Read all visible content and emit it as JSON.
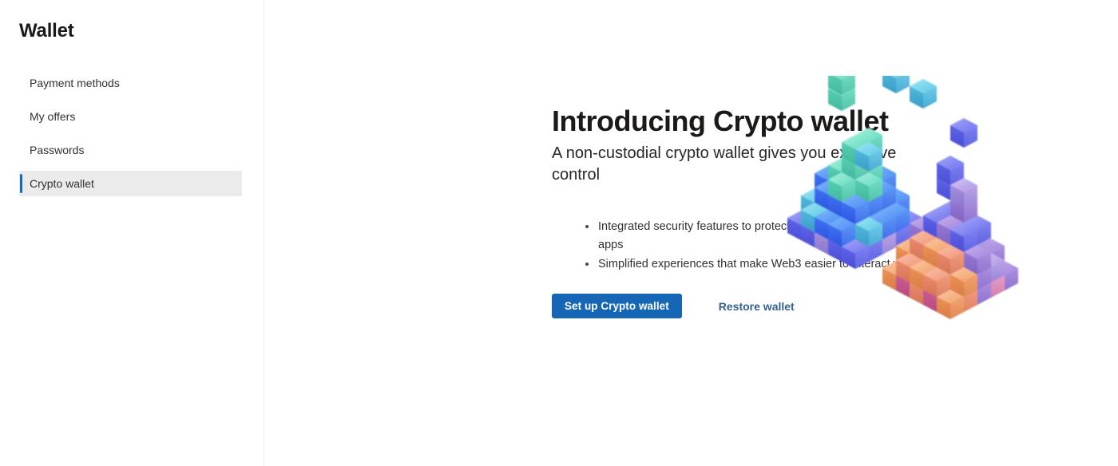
{
  "sidebar": {
    "title": "Wallet",
    "items": [
      {
        "label": "Payment methods",
        "selected": false
      },
      {
        "label": "My offers",
        "selected": false
      },
      {
        "label": "Passwords",
        "selected": false
      },
      {
        "label": "Crypto wallet",
        "selected": true
      }
    ],
    "accent_color": "#0f6cbd",
    "selected_bg": "#ebebeb"
  },
  "main": {
    "title": "Introducing Crypto wallet",
    "subtitle": "A non-custodial crypto wallet gives you exclusive control",
    "bullets": [
      "Integrated security features to protect you from unsecure addresses or apps",
      "Simplified experiences that make Web3 easier to interact with"
    ],
    "primary_button": {
      "label": "Set up Crypto wallet",
      "bg_color": "#1567b6",
      "text_color": "#ffffff"
    },
    "secondary_link": {
      "label": "Restore wallet",
      "text_color": "#34618c"
    },
    "illustration": {
      "name": "crypto-voxel-cubes-illustration",
      "description": "3D voxel cube cluster, blue-teal on the left and purple-pink-orange on the right, with small cubes floating above",
      "palette": {
        "blue": "#2d5ef0",
        "light_blue": "#4a8ef0",
        "cyan": "#4ec3e0",
        "teal": "#4fd8c0",
        "mint": "#6fe0b8",
        "indigo": "#6a6ae8",
        "lavender": "#a58fe0",
        "purple": "#9b7ddb",
        "pink": "#e08bc0",
        "magenta": "#d6629a",
        "salmon": "#ee8a6a",
        "orange": "#ef9060"
      }
    }
  },
  "page": {
    "background_color": "#ffffff",
    "divider_color": "#ebebeb"
  }
}
